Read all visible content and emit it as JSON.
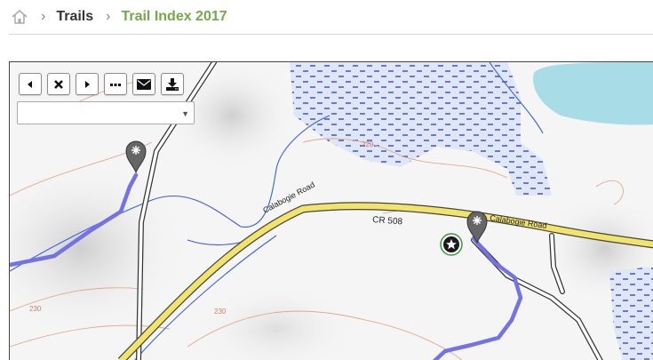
{
  "breadcrumb": {
    "home_icon": "home-icon",
    "separator": "›",
    "items": [
      {
        "label": "Trails"
      },
      {
        "label": "Trail Index 2017"
      }
    ]
  },
  "map": {
    "toolbar": [
      {
        "name": "previous-button",
        "icon": "caret-left-icon"
      },
      {
        "name": "close-button",
        "icon": "x-icon"
      },
      {
        "name": "next-button",
        "icon": "caret-right-icon"
      },
      {
        "name": "more-button",
        "icon": "ellipsis-icon"
      },
      {
        "name": "email-button",
        "icon": "envelope-icon"
      },
      {
        "name": "download-button",
        "icon": "download-icon"
      }
    ],
    "layer_select": {
      "value": "",
      "caret": "▼"
    },
    "labels": {
      "road_left": "Calabogie Road",
      "road_right": "Calabogie Road",
      "route": "CR 508",
      "contour_220": "220",
      "contour_230a": "230",
      "contour_230b": "230"
    },
    "colors": {
      "road": "#f2e36b",
      "trail": "#7373e6",
      "water": "#a8dce6",
      "wetland": "#dfe6f7",
      "accent": "#73a94a"
    }
  }
}
